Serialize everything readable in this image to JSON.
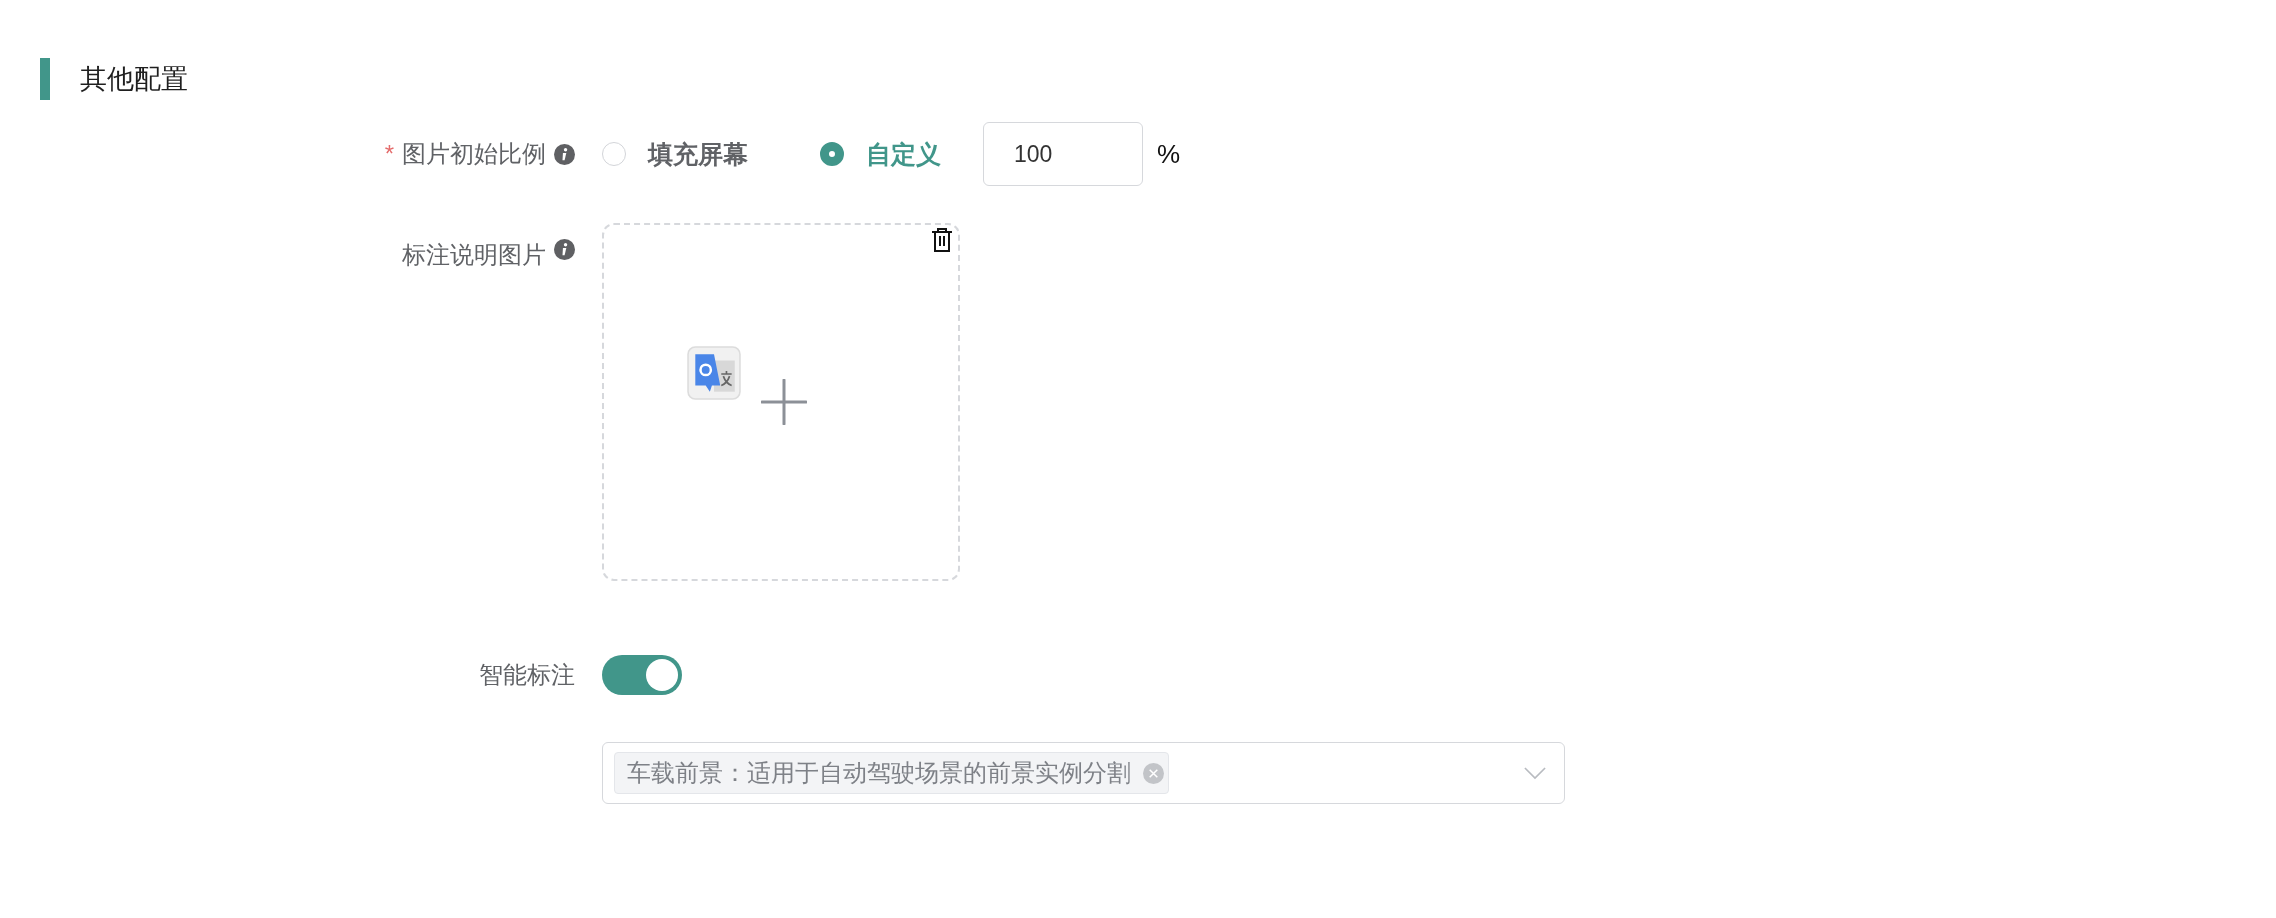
{
  "section": {
    "title": "其他配置"
  },
  "fields": [
    {
      "kind": "radio",
      "label": "图片初始比例",
      "required_mark": "*",
      "info": true,
      "options": [
        {
          "label": "填充屏幕",
          "selected": false
        },
        {
          "label": "自定义",
          "selected": true
        }
      ],
      "input": {
        "value": "100"
      },
      "unit": "%"
    },
    {
      "kind": "upload",
      "label": "标注说明图片",
      "info": true
    },
    {
      "kind": "switch",
      "label": "智能标注",
      "on": true
    },
    {
      "kind": "select",
      "tags": [
        {
          "label": "车载前景：适用于自动驾驶场景的前景实例分割"
        }
      ]
    }
  ]
}
